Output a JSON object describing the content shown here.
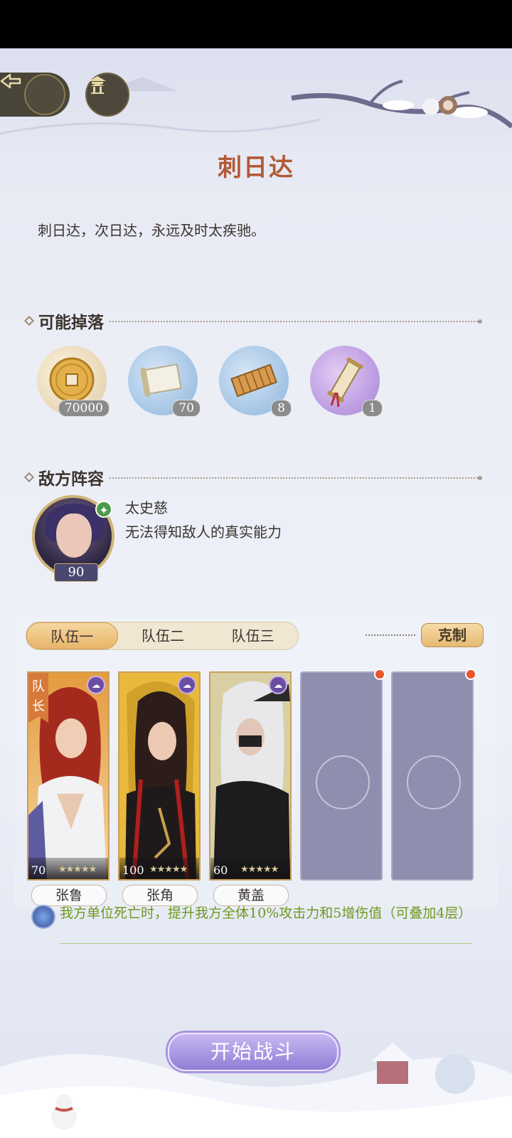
{
  "header": {
    "back_icon": "back-arrow-icon",
    "home_icon": "pavilion-icon"
  },
  "stage": {
    "title": "刺日达",
    "description": "刺日达，次日达，永远及时太疾驰。"
  },
  "drops": {
    "heading": "可能掉落",
    "items": [
      {
        "icon": "copper-coin-icon",
        "count": "70000"
      },
      {
        "icon": "scroll-icon",
        "count": "70"
      },
      {
        "icon": "bamboo-slip-icon",
        "count": "8"
      },
      {
        "icon": "sealed-scroll-icon",
        "count": "1"
      }
    ]
  },
  "enemy": {
    "heading": "敌方阵容",
    "name": "太史慈",
    "description": "无法得知敌人的真实能力",
    "level": "90"
  },
  "team": {
    "tabs": [
      "队伍一",
      "队伍二",
      "队伍三"
    ],
    "active_tab": 0,
    "counter_label": "克制",
    "leader_label": "队长",
    "members": [
      {
        "name": "张鲁",
        "level": "70",
        "stars": "★★★★★"
      },
      {
        "name": "张角",
        "level": "100",
        "stars": "★★★★★"
      },
      {
        "name": "黄盖",
        "level": "60",
        "stars": "★★★★★"
      }
    ]
  },
  "buff": {
    "text": "我方单位死亡时，提升我方全体10%攻击力和5增伤值（可叠加4层）"
  },
  "actions": {
    "start_label": "开始战斗"
  }
}
